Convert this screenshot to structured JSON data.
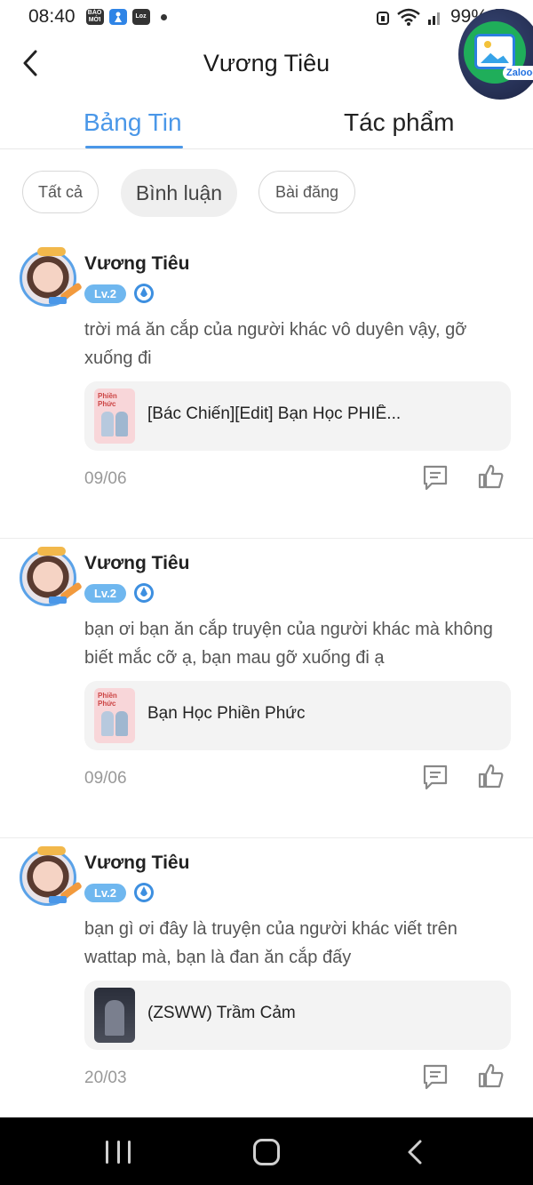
{
  "status_bar": {
    "time": "08:40",
    "app_badges": [
      "BÁO MỚI",
      "Zalo",
      "Loz"
    ],
    "battery": "99%"
  },
  "header": {
    "title": "Vương Tiêu",
    "floating_bubble_label": "Zaloooo"
  },
  "tabs": [
    {
      "label": "Bảng Tin",
      "active": true
    },
    {
      "label": "Tác phẩm",
      "active": false
    }
  ],
  "filters": [
    {
      "label": "Tất cả",
      "active": false
    },
    {
      "label": "Bình luận",
      "active": true
    },
    {
      "label": "Bài đăng",
      "active": false
    }
  ],
  "posts": [
    {
      "author": "Vương Tiêu",
      "level": "Lv.2",
      "comment": "trời má ăn cắp của người khác vô duyên vậy, gỡ xuống đi",
      "ref_title": "[Bác Chiến][Edit] Bạn Học PHIỀ...",
      "date": "09/06"
    },
    {
      "author": "Vương Tiêu",
      "level": "Lv.2",
      "comment": "bạn ơi bạn ăn cắp truyện của người khác mà không biết mắc cỡ ạ, bạn mau gỡ xuống đi ạ",
      "ref_title": "Bạn Học Phiền Phức",
      "date": "09/06"
    },
    {
      "author": "Vương Tiêu",
      "level": "Lv.2",
      "comment": "bạn gì ơi đây là truyện của người khác viết trên wattap mà, bạn là đan ăn cắp đấy",
      "ref_title": "(ZSWW) Trầm Cảm",
      "date": "20/03"
    }
  ],
  "colors": {
    "accent": "#4a97e8",
    "level_badge": "#6fb7ef",
    "chip_active_bg": "#efefef",
    "nav_bar": "#000000"
  }
}
